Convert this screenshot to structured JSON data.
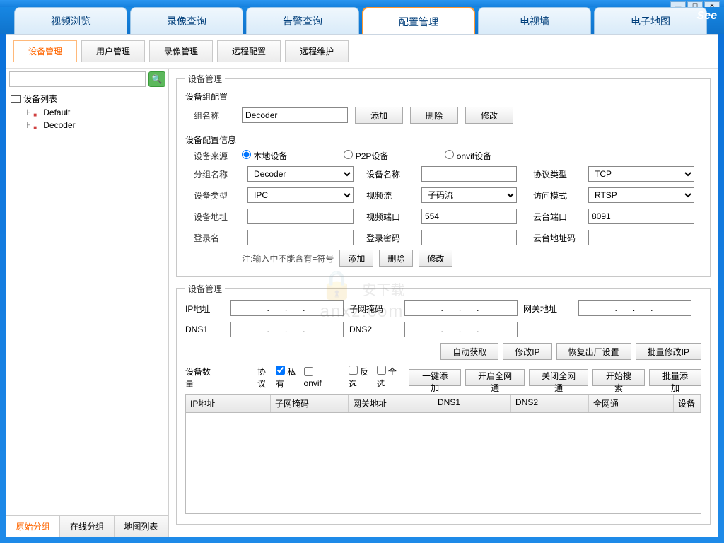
{
  "window": {
    "min": "—",
    "max": "☐",
    "close": "✕"
  },
  "logo": "See",
  "mainTabs": [
    "视频浏览",
    "录像查询",
    "告警查询",
    "配置管理",
    "电视墙",
    "电子地图"
  ],
  "mainActive": 3,
  "subTabs": [
    "设备管理",
    "用户管理",
    "录像管理",
    "远程配置",
    "远程维护"
  ],
  "subActive": 0,
  "search": {
    "placeholder": ""
  },
  "tree": {
    "root": "设备列表",
    "items": [
      "Default",
      "Decoder"
    ]
  },
  "sideTabs": [
    "原始分组",
    "在线分组",
    "地图列表"
  ],
  "sideActive": 0,
  "group": {
    "legend": "设备管理",
    "title": "设备组配置",
    "nameLabel": "组名称",
    "nameValue": "Decoder",
    "add": "添加",
    "del": "删除",
    "mod": "修改"
  },
  "dev": {
    "title": "设备配置信息",
    "srcLabel": "设备来源",
    "srcOpts": [
      "本地设备",
      "P2P设备",
      "onvif设备"
    ],
    "groupLabel": "分组名称",
    "groupValue": "Decoder",
    "nameLabel": "设备名称",
    "nameValue": "",
    "protoLabel": "协议类型",
    "protoValue": "TCP",
    "typeLabel": "设备类型",
    "typeValue": "IPC",
    "streamLabel": "视频流",
    "streamValue": "子码流",
    "accessLabel": "访问模式",
    "accessValue": "RTSP",
    "addrLabel": "设备地址",
    "addrValue": "",
    "vportLabel": "视频端口",
    "vportValue": "554",
    "ptzportLabel": "云台端口",
    "ptzportValue": "8091",
    "loginLabel": "登录名",
    "loginValue": "",
    "pwdLabel": "登录密码",
    "pwdValue": "",
    "ptzaddrLabel": "云台地址码",
    "ptzaddrValue": "",
    "note": "注:输入中不能含有=符号",
    "add": "添加",
    "del": "删除",
    "mod": "修改"
  },
  "net": {
    "legend": "设备管理",
    "ipLabel": "IP地址",
    "ipValue": ".   .   .",
    "maskLabel": "子网掩码",
    "maskValue": ".   .   .",
    "gwLabel": "网关地址",
    "gwValue": ".   .   .",
    "dns1Label": "DNS1",
    "dns1Value": ".   .   .",
    "dns2Label": "DNS2",
    "dns2Value": ".   .   .",
    "auto": "自动获取",
    "modip": "修改IP",
    "factory": "恢复出厂设置",
    "batchip": "批量修改IP",
    "countLabel": "设备数量",
    "protoLabel": "协议",
    "private": "私有",
    "onvif": "onvif",
    "invert": "反选",
    "all": "全选",
    "oneadd": "一键添加",
    "openall": "开启全网通",
    "closeall": "关闭全网通",
    "search": "开始搜索",
    "batchadd": "批量添加",
    "cols": [
      "IP地址",
      "子网掩码",
      "网关地址",
      "DNS1",
      "DNS2",
      "全网通",
      "设备"
    ]
  },
  "watermark": {
    "site": "anxz.com",
    "sub": "安下载"
  }
}
